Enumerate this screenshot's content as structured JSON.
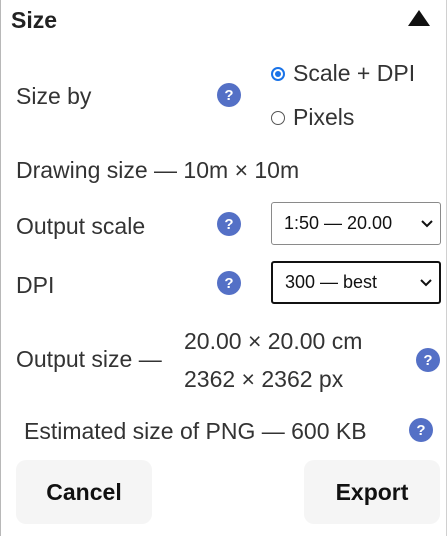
{
  "section": {
    "title": "Size"
  },
  "size_by": {
    "label": "Size by",
    "help": "?",
    "options": [
      {
        "label": "Scale + DPI",
        "checked": true
      },
      {
        "label": "Pixels",
        "checked": false
      }
    ]
  },
  "drawing_size": {
    "text": "Drawing size — 10m × 10m"
  },
  "output_scale": {
    "label": "Output scale",
    "help": "?",
    "value": "1:50 — 20.00"
  },
  "dpi": {
    "label": "DPI",
    "help": "?",
    "value": "300 — best"
  },
  "output_size": {
    "label": "Output size —",
    "line1": "20.00 × 20.00 cm",
    "line2": "2362 × 2362 px",
    "help": "?"
  },
  "estimate": {
    "text": "Estimated size of PNG — 600 KB",
    "help": "?"
  },
  "buttons": {
    "cancel": "Cancel",
    "export": "Export"
  },
  "colors": {
    "help_badge": "#5470c6",
    "radio_accent": "#1a73e8",
    "button_bg": "#f5f5f5"
  },
  "icons": {
    "collapse": "triangle-up-icon",
    "help": "help-circle-icon",
    "dropdown": "chevron-down-icon"
  }
}
